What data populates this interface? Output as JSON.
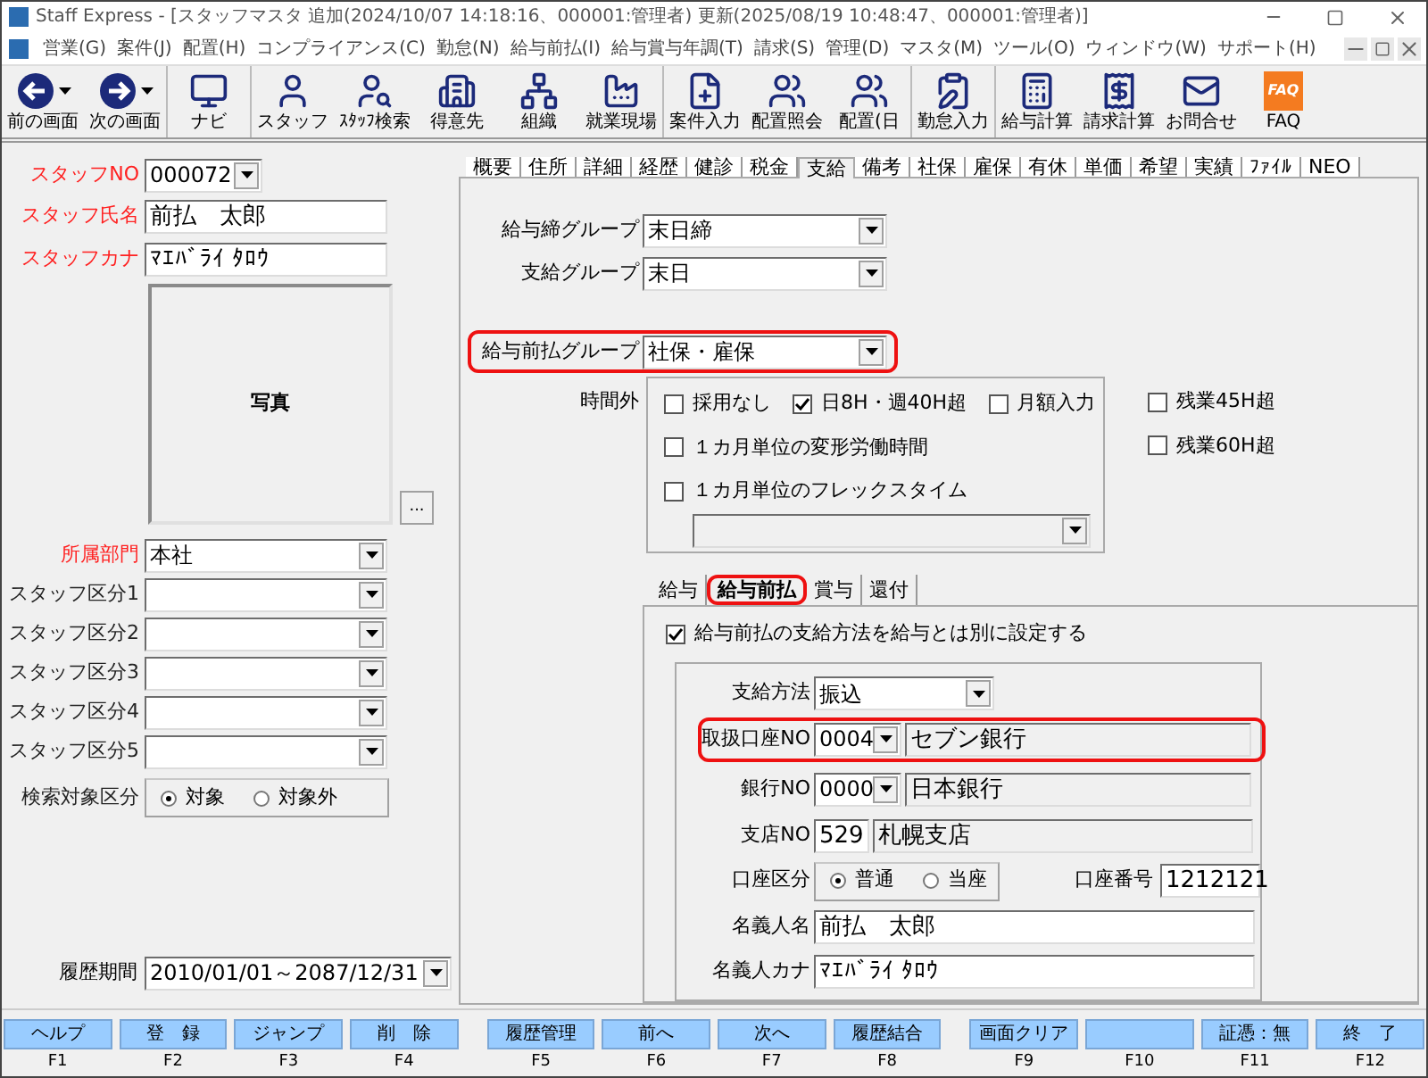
{
  "window": {
    "title": "Staff Express - [スタッフマスタ  追加(2024/10/07 14:18:16、000001:管理者)  更新(2025/08/19 10:48:47、000001:管理者)]"
  },
  "menu": [
    "営業(G)",
    "案件(J)",
    "配置(H)",
    "コンプライアンス(C)",
    "勤怠(N)",
    "給与前払(I)",
    "給与賞与年調(T)",
    "請求(S)",
    "管理(D)",
    "マスタ(M)",
    "ツール(O)",
    "ウィンドウ(W)",
    "サポート(H)"
  ],
  "toolbar_groups": [
    [
      {
        "label": "前の画面",
        "kind": "back",
        "dropdown": true
      },
      {
        "label": "次の画面",
        "kind": "forward",
        "dropdown": true
      }
    ],
    [
      {
        "label": "ナビ",
        "kind": "navi",
        "dropdown": false
      }
    ],
    [
      {
        "label": "スタッフ",
        "kind": "staff",
        "dropdown": false
      },
      {
        "label": "ｽﾀｯﾌ検索",
        "kind": "search",
        "dropdown": false
      },
      {
        "label": "得意先",
        "kind": "client",
        "dropdown": false
      },
      {
        "label": "組織",
        "kind": "org",
        "dropdown": false
      },
      {
        "label": "就業現場",
        "kind": "site",
        "dropdown": false
      }
    ],
    [
      {
        "label": "案件入力",
        "kind": "case",
        "dropdown": false
      },
      {
        "label": "配置照会",
        "kind": "placement",
        "dropdown": false
      },
      {
        "label": "配置(日",
        "kind": "placement",
        "dropdown": false
      }
    ],
    [
      {
        "label": "勤怠入力",
        "kind": "attendance",
        "dropdown": false
      }
    ],
    [
      {
        "label": "給与計算",
        "kind": "payroll",
        "dropdown": false
      },
      {
        "label": "請求計算",
        "kind": "billing",
        "dropdown": false
      },
      {
        "label": "お問合せ",
        "kind": "inquiry",
        "dropdown": false
      },
      {
        "label": "FAQ",
        "kind": "faq",
        "icon_text": "FAQ",
        "dropdown": false
      }
    ]
  ],
  "left": [
    {
      "kind": "combo",
      "label": "スタッフNO",
      "required": true,
      "value": "000072"
    },
    {
      "kind": "text",
      "label": "スタッフ氏名",
      "required": true,
      "value": "前払　太郎"
    },
    {
      "kind": "text",
      "label": "スタッフカナ",
      "required": true,
      "value": "ﾏｴﾊﾞﾗｲ ﾀﾛｳ"
    },
    {
      "kind": "photo",
      "caption": "写真",
      "button": "..."
    },
    {
      "kind": "combo",
      "label": "所属部門",
      "required": true,
      "value": "本社"
    },
    {
      "kind": "combo",
      "label": "スタッフ区分1",
      "required": false
    },
    {
      "kind": "combo",
      "label": "スタッフ区分2",
      "required": false
    },
    {
      "kind": "combo",
      "label": "スタッフ区分3",
      "required": false
    },
    {
      "kind": "combo",
      "label": "スタッフ区分4",
      "required": false
    },
    {
      "kind": "combo",
      "label": "スタッフ区分5",
      "required": false
    },
    {
      "kind": "radio",
      "label": "検索対象区分",
      "required": false,
      "options": [
        {
          "label": "対象",
          "selected": true
        },
        {
          "label": "対象外",
          "selected": false
        }
      ]
    }
  ],
  "history_period": {
    "label": "履歴期間",
    "value": "2010/01/01～2087/12/31"
  },
  "tabs": [
    {
      "label": "概要",
      "selected": false
    },
    {
      "label": "住所",
      "selected": false
    },
    {
      "label": "詳細",
      "selected": false
    },
    {
      "label": "経歴",
      "selected": false
    },
    {
      "label": "健診",
      "selected": false
    },
    {
      "label": "税金",
      "selected": false
    },
    {
      "label": "支給",
      "selected": true
    },
    {
      "label": "備考",
      "selected": false
    },
    {
      "label": "社保",
      "selected": false
    },
    {
      "label": "雇保",
      "selected": false
    },
    {
      "label": "有休",
      "selected": false
    },
    {
      "label": "単価",
      "selected": false
    },
    {
      "label": "希望",
      "selected": false
    },
    {
      "label": "実績",
      "selected": false
    },
    {
      "label": "ﾌｧｲﾙ",
      "selected": false
    },
    {
      "label": "NEO",
      "selected": false
    }
  ],
  "pay": {
    "groups": [
      {
        "label": "給与締グループ",
        "value": "末日締",
        "highlighted": false
      },
      {
        "label": "支給グループ",
        "value": "末日",
        "highlighted": false
      },
      {
        "label": "給与前払グループ",
        "value": "社保・雇保",
        "highlighted": true
      }
    ],
    "overtime": {
      "label": "時間外",
      "options": [
        {
          "label": "採用なし",
          "checked": false
        },
        {
          "label": "日8H・週40H超",
          "checked": true
        },
        {
          "label": "月額入力",
          "checked": false
        },
        {
          "label": "１カ月単位の変形労働時間",
          "checked": false
        },
        {
          "label": "１カ月単位のフレックスタイム",
          "checked": false
        }
      ],
      "extra": [
        {
          "label": "残業45H超",
          "checked": false
        },
        {
          "label": "残業60H超",
          "checked": false
        }
      ],
      "flex_combo": {
        "disabled": true
      }
    },
    "subtabs": [
      {
        "label": "給与",
        "selected": false,
        "highlighted": false
      },
      {
        "label": "給与前払",
        "selected": true,
        "highlighted": true
      },
      {
        "label": "賞与",
        "selected": false,
        "highlighted": false
      },
      {
        "label": "還付",
        "selected": false,
        "highlighted": false
      }
    ],
    "separate": {
      "label": "給与前払の支給方法を給与とは別に設定する",
      "checked": true
    },
    "method": {
      "label": "支給方法",
      "value": "振込"
    },
    "codes": [
      {
        "label": "取扱口座NO",
        "code": "0004",
        "name": "セブン銀行",
        "highlighted": true
      },
      {
        "label": "銀行NO",
        "code": "0000",
        "name": "日本銀行",
        "highlighted": false
      }
    ],
    "branch": {
      "label": "支店NO",
      "code": "529",
      "name": "札幌支店"
    },
    "account_type": {
      "label": "口座区分",
      "options": [
        {
          "label": "普通",
          "selected": true
        },
        {
          "label": "当座",
          "selected": false
        }
      ]
    },
    "account_number": {
      "label": "口座番号",
      "value": "1212121"
    },
    "holder_name": {
      "label": "名義人名",
      "value": "前払　太郎"
    },
    "holder_kana": {
      "label": "名義人カナ",
      "value": "ﾏｴﾊﾞﾗｲ ﾀﾛｳ"
    }
  },
  "function_keys": [
    {
      "label": "ヘルプ",
      "key": "F1"
    },
    {
      "label": "登　録",
      "key": "F2"
    },
    {
      "label": "ジャンプ",
      "key": "F3"
    },
    {
      "label": "削　除",
      "key": "F4"
    },
    {
      "label": "履歴管理",
      "key": "F5"
    },
    {
      "label": "前へ",
      "key": "F6"
    },
    {
      "label": "次へ",
      "key": "F7"
    },
    {
      "label": "履歴結合",
      "key": "F8"
    },
    {
      "label": "画面クリア",
      "key": "F9"
    },
    {
      "key": "F10"
    },
    {
      "label": "証憑：無",
      "key": "F11"
    },
    {
      "label": "終　了",
      "key": "F12"
    }
  ]
}
